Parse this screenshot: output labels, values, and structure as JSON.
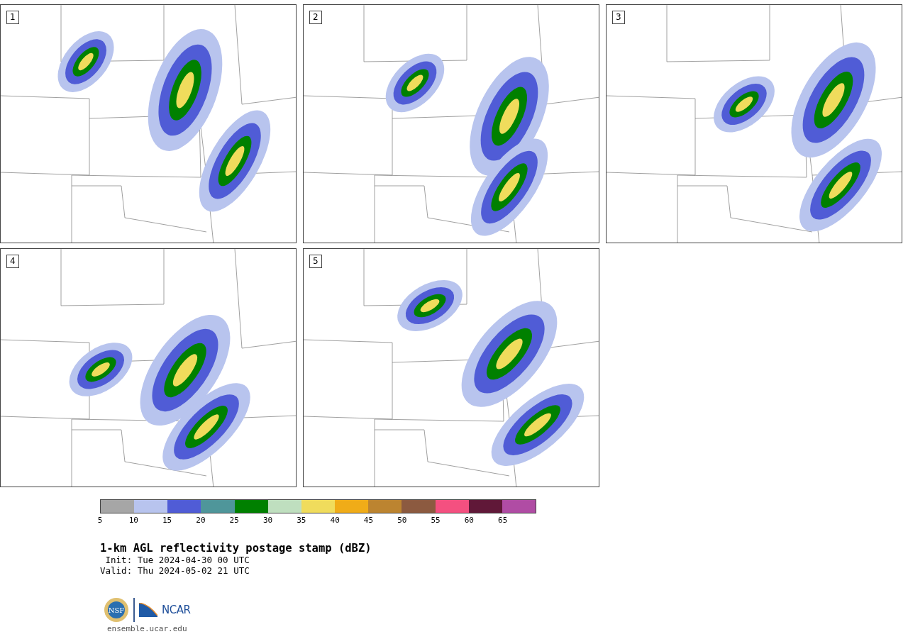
{
  "panels": [
    {
      "label": "1"
    },
    {
      "label": "2"
    },
    {
      "label": "3"
    },
    {
      "label": "4"
    },
    {
      "label": "5"
    }
  ],
  "colorbar": {
    "segments": [
      {
        "color": "#a6a6a6",
        "tick": "5"
      },
      {
        "color": "#b8c4ee",
        "tick": "10"
      },
      {
        "color": "#505cd6",
        "tick": "15"
      },
      {
        "color": "#4f969a",
        "tick": "20"
      },
      {
        "color": "#008000",
        "tick": "25"
      },
      {
        "color": "#bfdfbf",
        "tick": "30"
      },
      {
        "color": "#f0dc5c",
        "tick": "35"
      },
      {
        "color": "#f0ac18",
        "tick": "40"
      },
      {
        "color": "#bc8430",
        "tick": "45"
      },
      {
        "color": "#8c5a40",
        "tick": "50"
      },
      {
        "color": "#f45080",
        "tick": "55"
      },
      {
        "color": "#601838",
        "tick": "60"
      },
      {
        "color": "#b04ca4",
        "tick": "65"
      }
    ]
  },
  "title": "1-km AGL reflectivity postage stamp (dBZ)",
  "init": " Init: Tue 2024-04-30 00 UTC",
  "valid": "Valid: Thu 2024-05-02 21 UTC",
  "logos": {
    "left": "NSF",
    "right": "NCAR"
  },
  "url": "ensemble.ucar.edu"
}
